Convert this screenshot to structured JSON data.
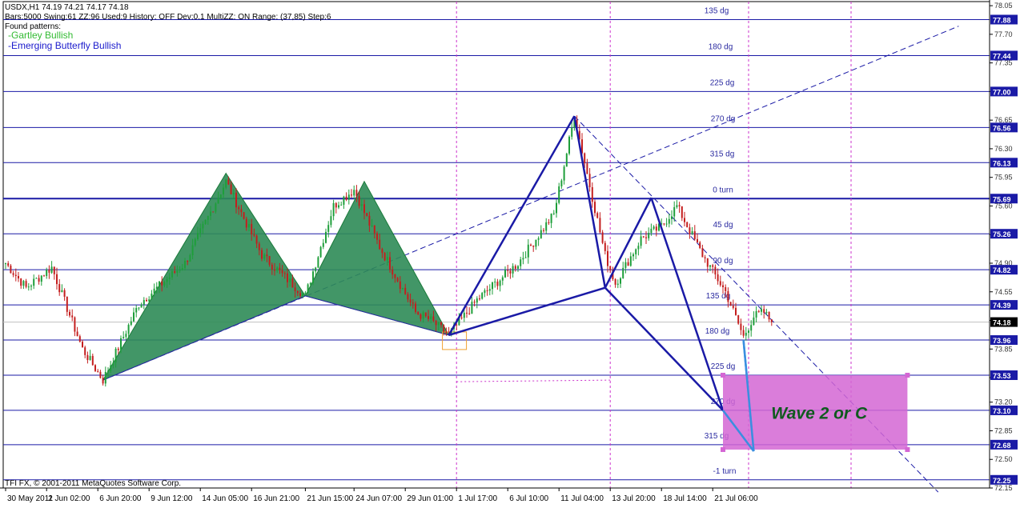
{
  "header": {
    "line1": "USDX,H1  74.19 74.21 74.17 74.18",
    "line2": "Bars:5000  Swing:61  ZZ:96  Used:9  History: OFF Dev:0.1  MultiZZ: ON  Range: (37,85)  Step:6",
    "found_label": "Found patterns:",
    "pattern1": "-Gartley Bullish",
    "pattern2": "-Emerging Butterfly Bullish",
    "pattern1_color": "#33bb33",
    "pattern2_color": "#1a1acc"
  },
  "footer": {
    "copyright": "TFI FX, © 2001-2011 MetaQuotes Software Corp."
  },
  "annotation": {
    "box_label": "Wave 2 or C",
    "box_color": "#d466d4",
    "label_color": "#0f5a1e"
  },
  "chart_data": {
    "type": "candlestick",
    "symbol": "USDX",
    "timeframe": "H1",
    "ylim": [
      72.15,
      78.1
    ],
    "y_ticks": [
      72.15,
      72.5,
      72.85,
      73.2,
      73.5,
      73.85,
      74.2,
      74.55,
      74.9,
      75.25,
      75.6,
      75.95,
      76.3,
      76.65,
      77.0,
      77.35,
      77.7,
      78.05
    ],
    "y_tick_labels": [
      "72.15",
      "72.50",
      "72.85",
      "73.20",
      "73.50",
      "73.85",
      "74.20",
      "74.55",
      "74.90",
      "75.25",
      "75.60",
      "75.95",
      "76.30",
      "76.65",
      "77.00",
      "77.35",
      "77.70",
      "78.05"
    ],
    "x_labels": [
      "30 May 2011",
      "2 Jun 02:00",
      "6 Jun 20:00",
      "9 Jun 12:00",
      "14 Jun 05:00",
      "16 Jun 21:00",
      "21 Jun 15:00",
      "24 Jun 07:00",
      "29 Jun 01:00",
      "1 Jul 17:00",
      "6 Jul 10:00",
      "11 Jul 04:00",
      "13 Jul 20:00",
      "18 Jul 14:00",
      "21 Jul 06:00"
    ],
    "x_label_bars": [
      0,
      16,
      36,
      56,
      76,
      96,
      117,
      136,
      156,
      176,
      196,
      216,
      236,
      256,
      276
    ],
    "bar_count": 300,
    "last_price": 74.18,
    "levels": [
      {
        "price": 77.88,
        "label": "135 dg"
      },
      {
        "price": 77.44,
        "label": "180 dg"
      },
      {
        "price": 77.0,
        "label": "225 dg"
      },
      {
        "price": 76.56,
        "label": "270 dg"
      },
      {
        "price": 76.13,
        "label": "315 dg"
      },
      {
        "price": 75.69,
        "label": "0 turn"
      },
      {
        "price": 75.26,
        "label": "45 dg"
      },
      {
        "price": 74.82,
        "label": "90 dg"
      },
      {
        "price": 74.39,
        "label": "135 dg"
      },
      {
        "price": 73.96,
        "label": "180 dg"
      },
      {
        "price": 73.53,
        "label": "225 dg"
      },
      {
        "price": 73.1,
        "label": "270 dg"
      },
      {
        "price": 72.68,
        "label": "315 dg"
      },
      {
        "price": 72.25,
        "label": "-1 turn"
      }
    ],
    "level_tags": [
      "77.88",
      "77.44",
      "77.00",
      "76.56",
      "76.13",
      "75.69",
      "75.26",
      "74.82",
      "74.39",
      "73.96",
      "73.53",
      "73.10",
      "72.68",
      "72.25"
    ],
    "last_price_tag": "74.18",
    "vertical_marker_bars": [
      176,
      236,
      290,
      330
    ],
    "pivots": [
      {
        "bar": 0,
        "price": 74.9
      },
      {
        "bar": 8,
        "price": 74.6
      },
      {
        "bar": 18,
        "price": 74.85
      },
      {
        "bar": 30,
        "price": 73.85
      },
      {
        "bar": 38,
        "price": 73.47
      },
      {
        "bar": 52,
        "price": 74.4
      },
      {
        "bar": 70,
        "price": 74.9
      },
      {
        "bar": 86,
        "price": 75.9
      },
      {
        "bar": 100,
        "price": 75.0
      },
      {
        "bar": 110,
        "price": 74.7
      },
      {
        "bar": 117,
        "price": 74.5
      },
      {
        "bar": 128,
        "price": 75.6
      },
      {
        "bar": 136,
        "price": 75.8
      },
      {
        "bar": 146,
        "price": 75.1
      },
      {
        "bar": 160,
        "price": 74.3
      },
      {
        "bar": 166,
        "price": 74.2
      },
      {
        "bar": 173,
        "price": 74.02
      },
      {
        "bar": 184,
        "price": 74.45
      },
      {
        "bar": 200,
        "price": 74.9
      },
      {
        "bar": 214,
        "price": 75.5
      },
      {
        "bar": 222,
        "price": 76.7
      },
      {
        "bar": 234,
        "price": 75.0
      },
      {
        "bar": 238,
        "price": 74.65
      },
      {
        "bar": 248,
        "price": 75.2
      },
      {
        "bar": 256,
        "price": 75.35
      },
      {
        "bar": 262,
        "price": 75.6
      },
      {
        "bar": 272,
        "price": 75.0
      },
      {
        "bar": 281,
        "price": 74.55
      },
      {
        "bar": 288,
        "price": 74.0
      },
      {
        "bar": 292,
        "price": 74.25
      },
      {
        "bar": 296,
        "price": 74.3
      },
      {
        "bar": 299,
        "price": 74.18
      }
    ],
    "gartley_points": [
      {
        "bar": 38,
        "price": 73.47
      },
      {
        "bar": 86,
        "price": 76.0
      },
      {
        "bar": 117,
        "price": 74.5
      },
      {
        "bar": 140,
        "price": 75.9
      },
      {
        "bar": 173,
        "price": 74.02
      }
    ],
    "butterfly_points": [
      {
        "bar": 173,
        "price": 74.02
      },
      {
        "bar": 222,
        "price": 76.7
      },
      {
        "bar": 234,
        "price": 74.6
      },
      {
        "bar": 252,
        "price": 75.7
      },
      {
        "bar": 280,
        "price": 73.1
      },
      {
        "bar": 292,
        "price": 72.6
      }
    ],
    "target_zone": {
      "bar_start": 280,
      "bar_end": 352,
      "price_high": 73.53,
      "price_low": 72.62
    },
    "trendlines": [
      {
        "bar1": 38,
        "price1": 73.47,
        "bar2": 372,
        "price2": 77.8
      },
      {
        "bar1": 222,
        "price1": 76.7,
        "bar2": 364,
        "price2": 72.1
      }
    ]
  }
}
